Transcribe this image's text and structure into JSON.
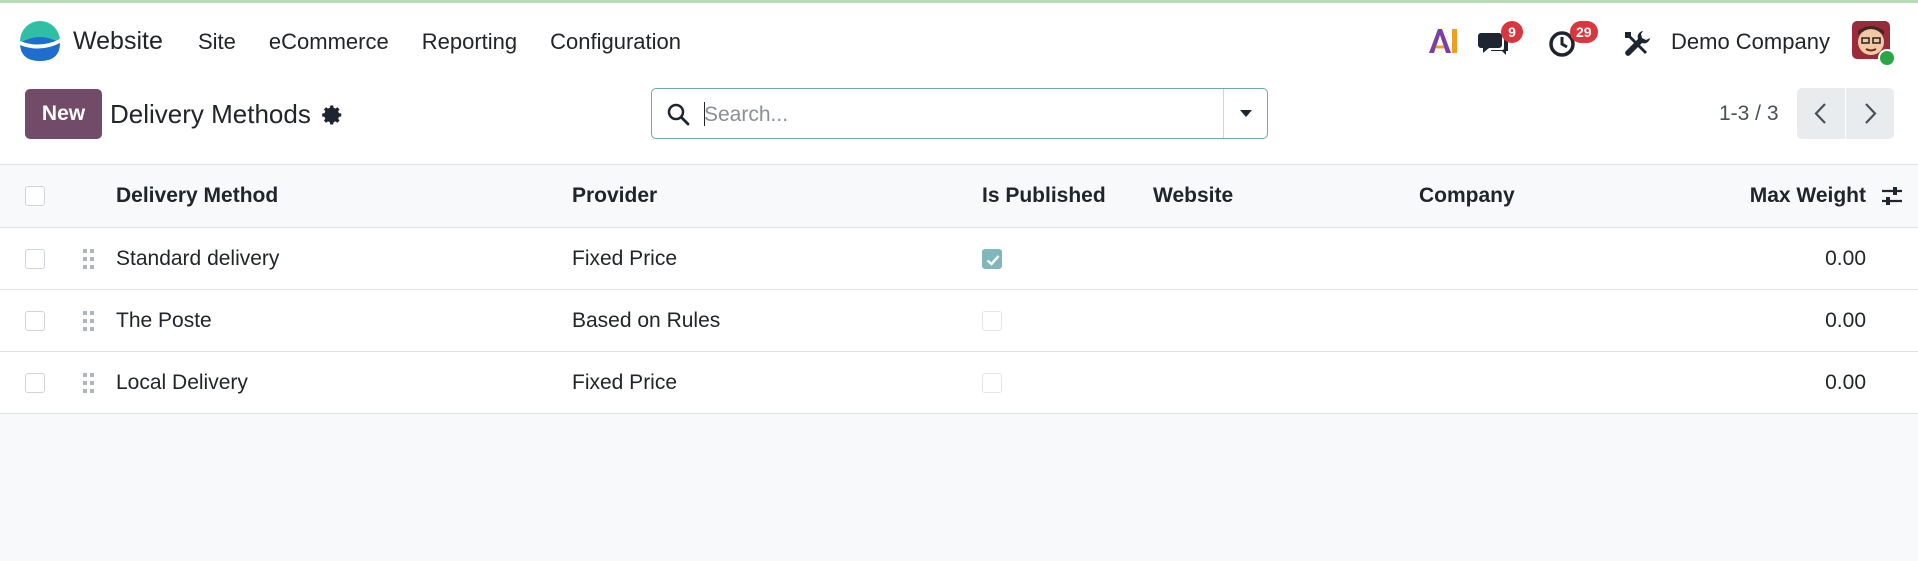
{
  "app": {
    "name": "Website"
  },
  "menu": [
    {
      "label": "Site"
    },
    {
      "label": "eCommerce"
    },
    {
      "label": "Reporting"
    },
    {
      "label": "Configuration"
    }
  ],
  "systray": {
    "ai_icon": "ai-icon",
    "messages_badge": "9",
    "activities_badge": "29",
    "company": "Demo Company"
  },
  "control": {
    "new_label": "New",
    "title": "Delivery Methods",
    "search_placeholder": "Search...",
    "pager": "1-3 / 3"
  },
  "table": {
    "columns": [
      "Delivery Method",
      "Provider",
      "Is Published",
      "Website",
      "Company",
      "Max Weight"
    ],
    "rows": [
      {
        "name": "Standard delivery",
        "provider": "Fixed Price",
        "published": true,
        "website": "",
        "company": "",
        "max_weight": "0.00"
      },
      {
        "name": "The Poste",
        "provider": "Based on Rules",
        "published": false,
        "website": "",
        "company": "",
        "max_weight": "0.00"
      },
      {
        "name": "Local Delivery",
        "provider": "Fixed Price",
        "published": false,
        "website": "",
        "company": "",
        "max_weight": "0.00"
      }
    ]
  },
  "colors": {
    "brand": "#714b67",
    "badge": "#d9363e",
    "accent": "#7fb7bd"
  }
}
